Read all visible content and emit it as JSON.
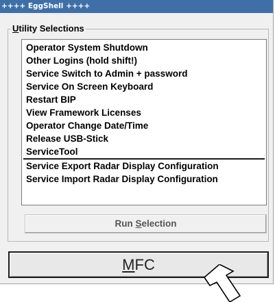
{
  "window": {
    "title": "++++ EggShell ++++"
  },
  "utility": {
    "group_accel": "U",
    "group_rest": "tility Selections",
    "items": [
      "Operator System Shutdown",
      "Other Logins (hold shift!)",
      "Service Switch to Admin + password",
      "Service On Screen Keyboard",
      "Restart BIP",
      "View Framework Licenses",
      "Operator Change Date/Time",
      "Release USB-Stick",
      "ServiceTool",
      "Service Export Radar Display Configuration",
      "Service Import Radar Display Configuration"
    ],
    "run_button": {
      "pre": "Run ",
      "accel": "S",
      "post": "election"
    }
  },
  "mfc_button": {
    "accel": "M",
    "rest": "FC"
  },
  "colors": {
    "titlebar": "#3e6fa8",
    "background": "#f0f0f0",
    "list_background": "#ffffff"
  },
  "icons": {
    "pointer": "up-right-arrow-icon"
  }
}
